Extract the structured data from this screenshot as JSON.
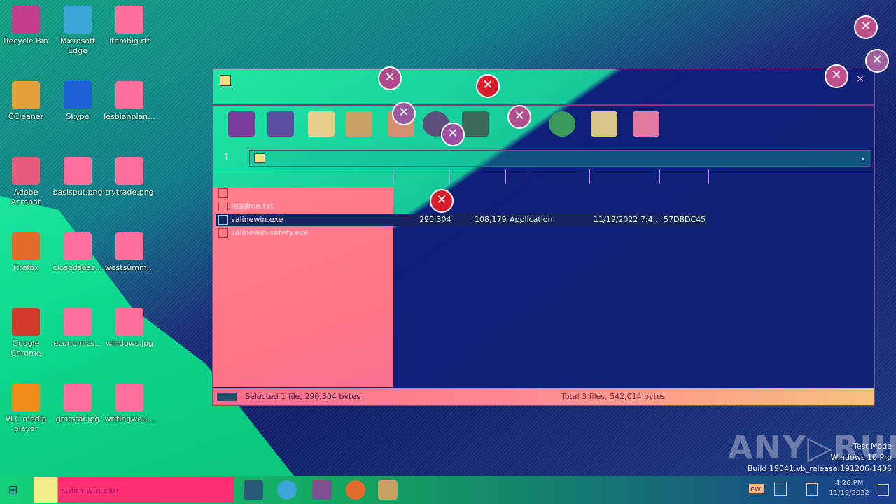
{
  "desktop": {
    "icons": [
      {
        "label": "Recycle Bin",
        "color": "#c43c8c"
      },
      {
        "label": "Microsoft Edge",
        "color": "#3aa6d6"
      },
      {
        "label": "itembig.rtf",
        "color": "#ff6f9c"
      },
      {
        "label": "CCleaner",
        "color": "#e6a03a"
      },
      {
        "label": "Skype",
        "color": "#1f62d8"
      },
      {
        "label": "lesbianplan...",
        "color": "#ff6f9c"
      },
      {
        "label": "Adobe Acrobat",
        "color": "#e75a7a"
      },
      {
        "label": "basisput.png",
        "color": "#ff6f9c"
      },
      {
        "label": "trytrade.png",
        "color": "#ff6f9c"
      },
      {
        "label": "Firefox",
        "color": "#e46b2c"
      },
      {
        "label": "closedseas...",
        "color": "#ff6f9c"
      },
      {
        "label": "westsumm...",
        "color": "#ff6f9c"
      },
      {
        "label": "Google Chrome",
        "color": "#d5392c"
      },
      {
        "label": "economics...",
        "color": "#ff6f9c"
      },
      {
        "label": "windows.jpg",
        "color": "#ff6f9c"
      },
      {
        "label": "VLC media player",
        "color": "#f08c1a"
      },
      {
        "label": "gmtstar.jpg",
        "color": "#ff6f9c"
      },
      {
        "label": "writingwou...",
        "color": "#ff6f9c"
      }
    ]
  },
  "window": {
    "close_symbol": "×",
    "toolbar_icons": [
      "wrench-icon",
      "folder-icon",
      "checklist-icon",
      "book-icon",
      "archive-icon",
      "magnifier-icon",
      "wand-icon",
      "bug-icon",
      "note-icon",
      "box-icon"
    ],
    "address_chevron": "⌄",
    "up_symbol": "↑",
    "files": [
      {
        "name": "..",
        "size": "",
        "packed": "",
        "type": "",
        "modified": "",
        "crc": ""
      },
      {
        "name": "readme.txt",
        "size": "",
        "packed": "",
        "type": "",
        "modified": "",
        "crc": ""
      },
      {
        "name": "salinewin.exe",
        "size": "290,304",
        "packed": "108,179",
        "type": "Application",
        "modified": "11/19/2022 7:4...",
        "crc": "57DBDC45"
      },
      {
        "name": "salinewin-safety.exe",
        "size": "",
        "packed": "",
        "type": "",
        "modified": "",
        "crc": ""
      }
    ],
    "status_left": "Selected 1 file, 290,304 bytes",
    "status_right": "Total 3 files, 542,014 bytes"
  },
  "error_icon_symbol": "✕",
  "taskbar": {
    "start_symbol": "⊞",
    "search_text": "salinewin.exe",
    "tray_label": "cwi",
    "time": "4:26 PM",
    "date": "11/19/2022"
  },
  "watermark": {
    "brand": "ANY▷RUN",
    "line1": "Test Mode",
    "line2": "Windows 10 Pro",
    "line3": "Build 19041.vb_release.191206-1406"
  }
}
